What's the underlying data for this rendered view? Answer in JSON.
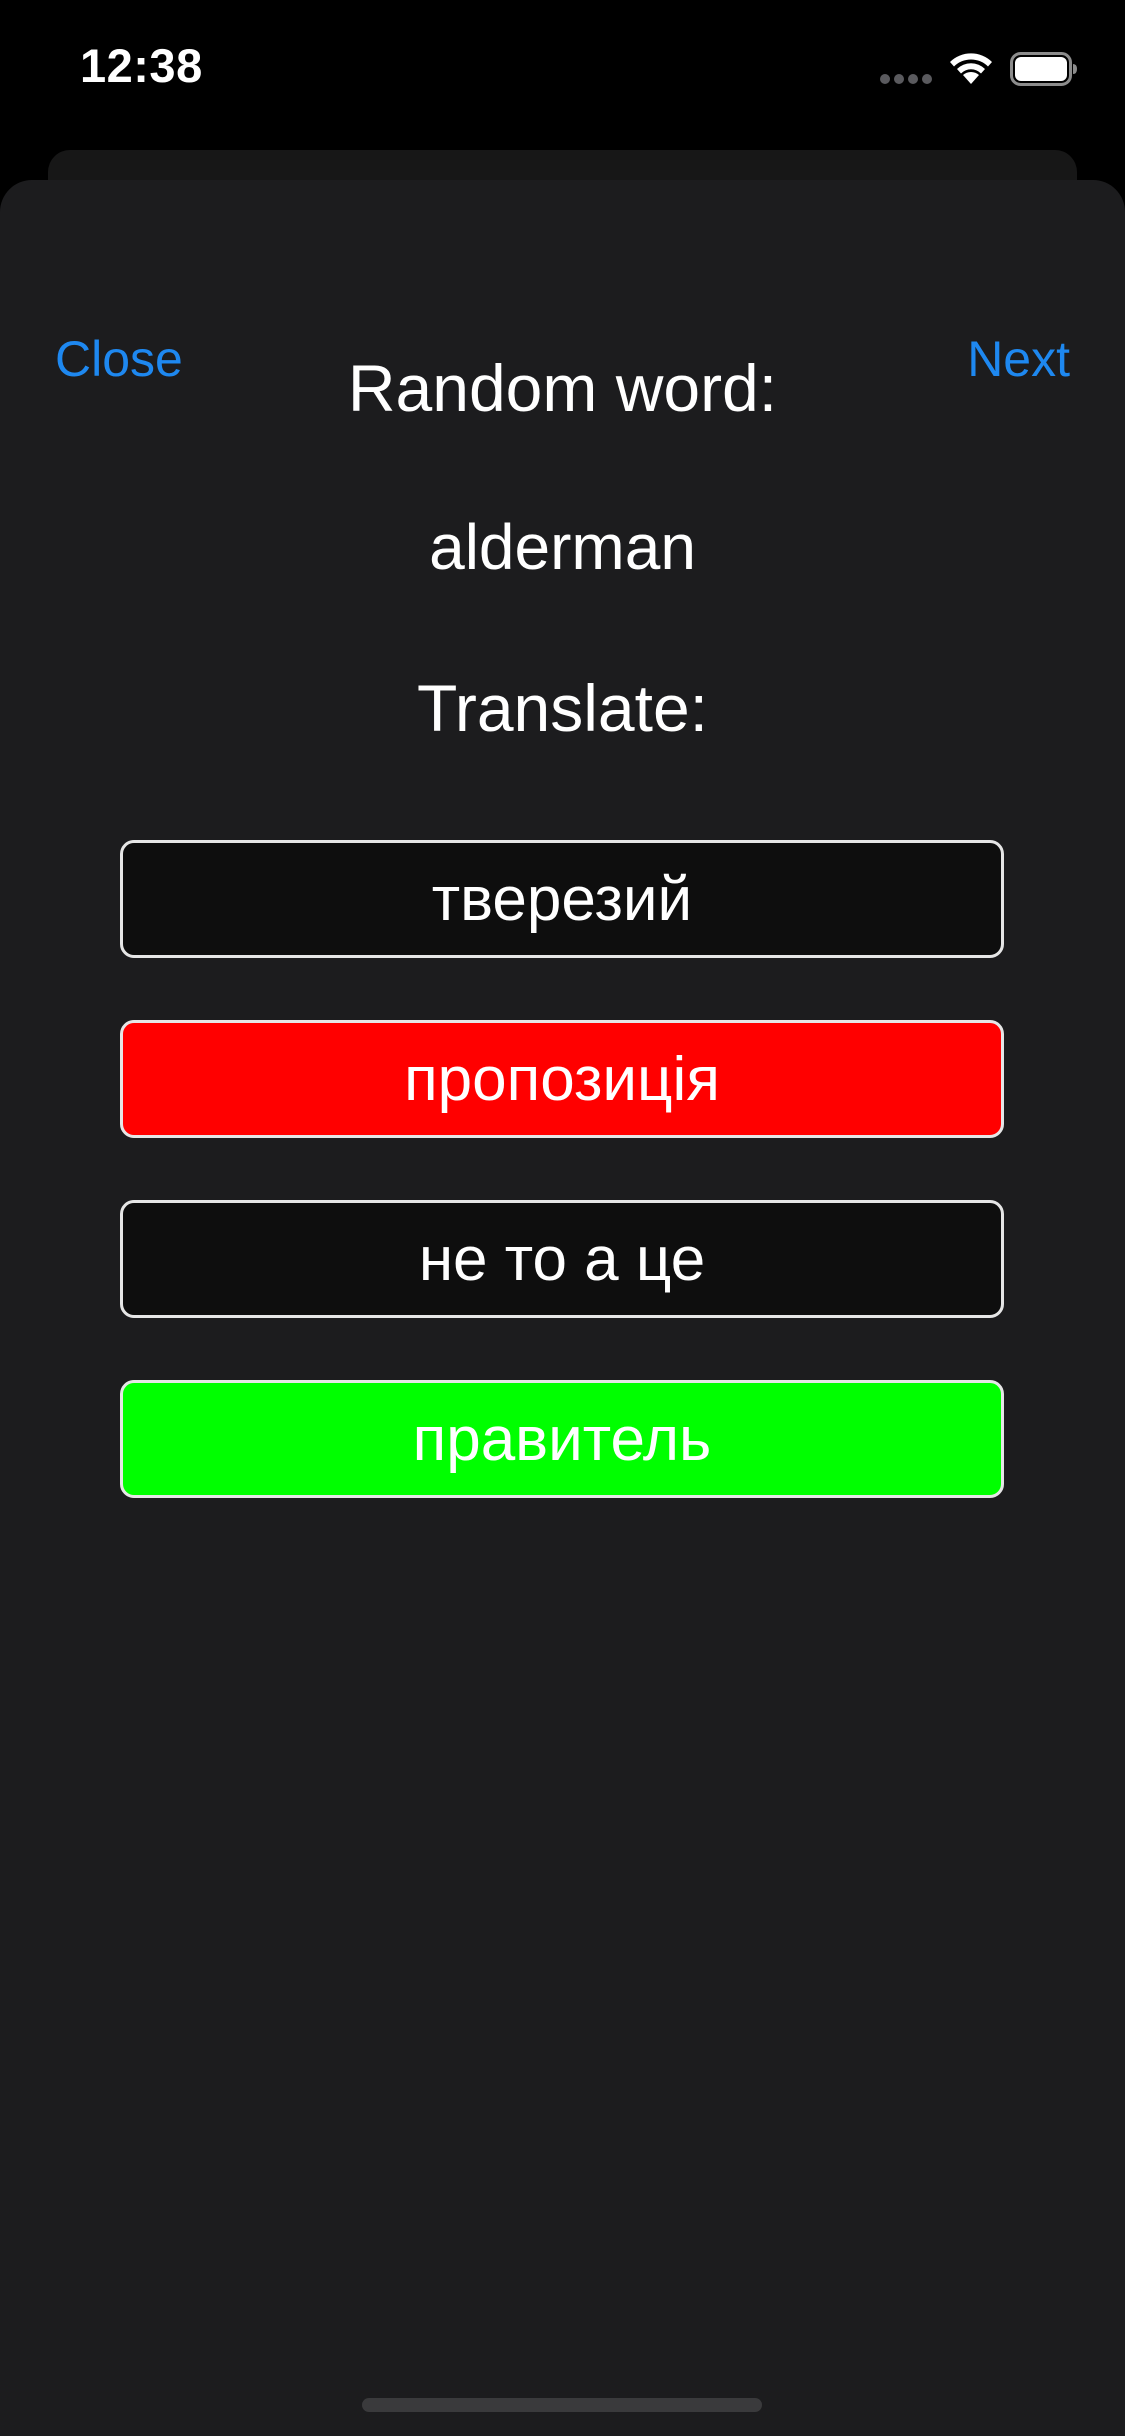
{
  "status_bar": {
    "time": "12:38"
  },
  "nav": {
    "close_label": "Close",
    "next_label": "Next"
  },
  "quiz": {
    "heading": "Random word:",
    "word": "alderman",
    "translate_heading": "Translate:",
    "answers": [
      {
        "label": "тверезий",
        "state": "default"
      },
      {
        "label": "пропозиція",
        "state": "incorrect"
      },
      {
        "label": "не то а це",
        "state": "default"
      },
      {
        "label": "правитель",
        "state": "correct"
      }
    ]
  },
  "colors": {
    "accent": "#1e88f0",
    "incorrect": "#ff0000",
    "correct": "#00ff00",
    "sheet_background": "#1c1c1e"
  },
  "icons": {
    "signal": "cellular-signal-icon",
    "wifi": "wifi-icon",
    "battery": "battery-icon"
  }
}
